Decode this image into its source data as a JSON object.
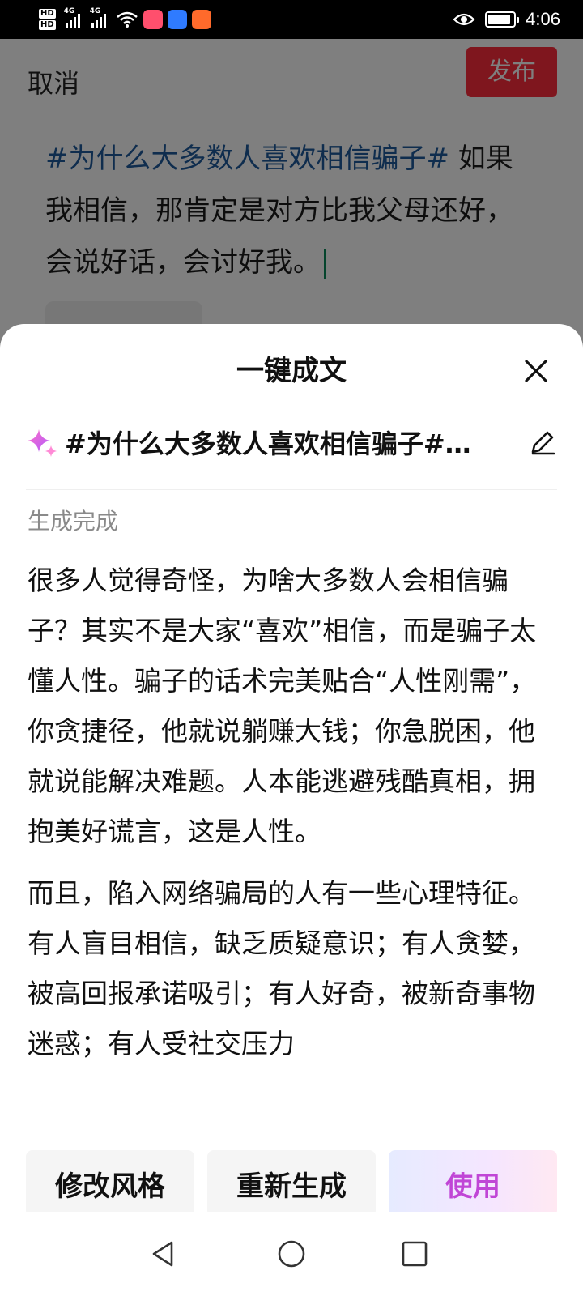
{
  "status_bar": {
    "hd1": "HD",
    "hd2": "HD",
    "network1": "4G",
    "network2": "4G",
    "time": "4:06",
    "battery_level": 0.9
  },
  "composer": {
    "cancel_label": "取消",
    "publish_label": "发布",
    "hashtag": "#为什么大多数人喜欢相信骗子#",
    "body_text": " 如果我相信，那肯定是对方比我父母还好，会说好话，会讨好我。"
  },
  "sheet": {
    "title": "一键成文",
    "topic": "#为什么大多数人喜欢相信骗子#…",
    "status": "生成完成",
    "paragraphs": [
      "很多人觉得奇怪，为啥大多数人会相信骗子？其实不是大家“喜欢”相信，而是骗子太懂人性。骗子的话术完美贴合“人性刚需”，你贪捷径，他就说躺赚大钱；你急脱困，他就说能解决难题。人本能逃避残酷真相，拥抱美好谎言，这是人性。",
      "而且，陷入网络骗局的人有一些心理特征。有人盲目相信，缺乏质疑意识；有人贪婪，被高回报承诺吸引；有人好奇，被新奇事物迷惑；有人受社交压力"
    ],
    "buttons": {
      "modify_style": "修改风格",
      "regenerate": "重新生成",
      "use": "使用"
    }
  },
  "colors": {
    "publish": "#ff2d3c",
    "hashtag": "#1e5a9c",
    "use_text": "#c046d6"
  }
}
